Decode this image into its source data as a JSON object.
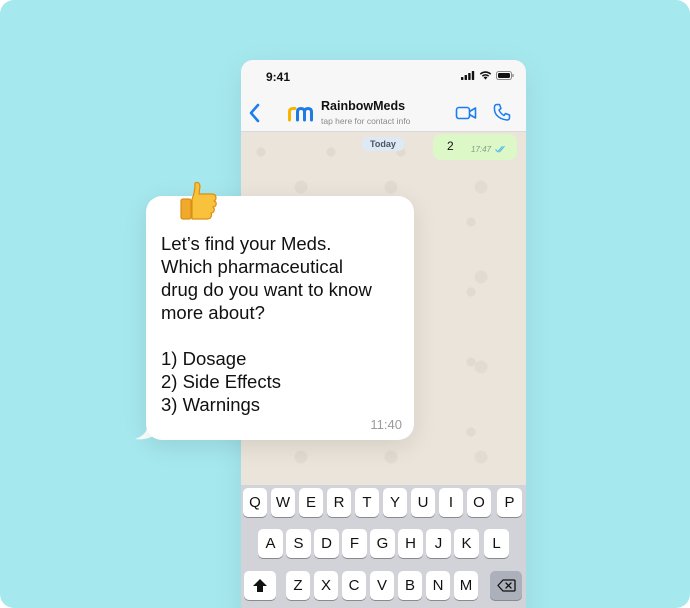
{
  "status": {
    "time": "9:41"
  },
  "header": {
    "back_icon": "chevron-left-icon",
    "logo_text": "rm",
    "contact_name": "RainbowMeds",
    "contact_subtitle": "tap here for contact info",
    "video_icon": "video-camera-icon",
    "call_icon": "phone-icon"
  },
  "chat": {
    "date_badge": "Today",
    "sent_message": {
      "text": "2",
      "time": "17:47",
      "status_icon": "double-check-icon"
    }
  },
  "incoming": {
    "emoji": "👍",
    "text": "Let’s find your Meds.\nWhich pharmaceutical\ndrug do you want to know\nmore about?\n\n1) Dosage\n2) Side Effects\n3) Warnings",
    "time": "11:40"
  },
  "keyboard": {
    "row1": [
      "Q",
      "W",
      "E",
      "R",
      "T",
      "Y",
      "U",
      "I",
      "O",
      "P"
    ],
    "row2": [
      "A",
      "S",
      "D",
      "F",
      "G",
      "H",
      "J",
      "K",
      "L"
    ],
    "row3": [
      "Z",
      "X",
      "C",
      "V",
      "B",
      "N",
      "M"
    ],
    "shift_icon": "shift-icon",
    "backspace_icon": "backspace-icon"
  },
  "colors": {
    "background": "#a5e8ee",
    "ios_blue": "#1a7ef2",
    "sent_bubble": "#dcf8c6",
    "logo_blue": "#1e7be5",
    "logo_yellow": "#f7b500"
  }
}
